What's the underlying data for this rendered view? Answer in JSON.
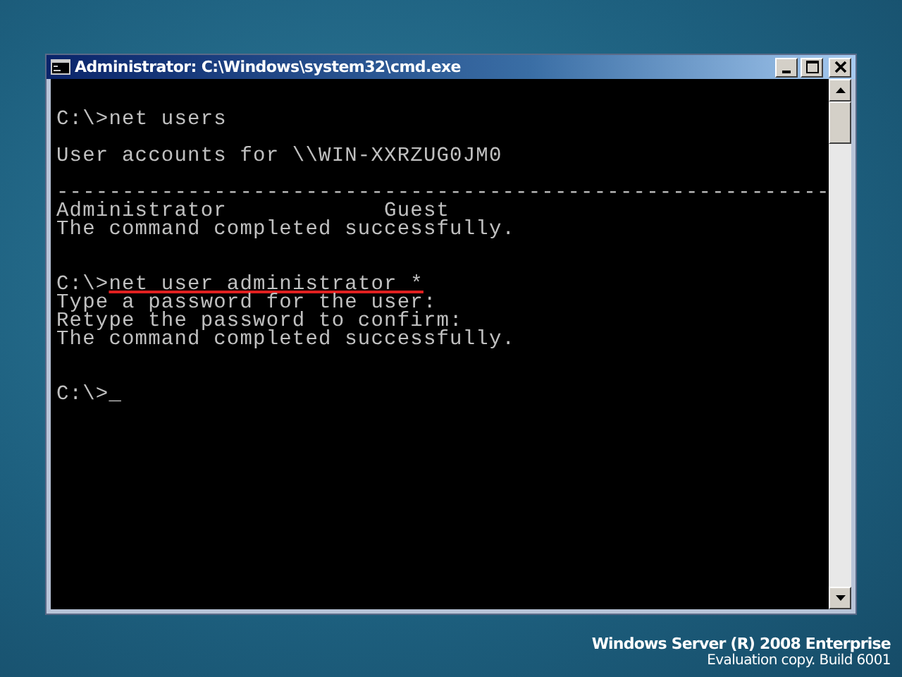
{
  "window": {
    "title": "Administrator: C:\\Windows\\system32\\cmd.exe"
  },
  "console": {
    "lines": [
      {
        "kind": "command",
        "prompt": "C:\\>",
        "text": "net users",
        "underlined": false
      },
      {
        "kind": "blank"
      },
      {
        "kind": "output",
        "text": "User accounts for \\\\WIN-XXRZUG0JM0"
      },
      {
        "kind": "blank"
      },
      {
        "kind": "output",
        "text": "-----------------------------------------------------------"
      },
      {
        "kind": "output",
        "text": "Administrator            Guest"
      },
      {
        "kind": "output",
        "text": "The command completed successfully."
      },
      {
        "kind": "blank"
      },
      {
        "kind": "blank"
      },
      {
        "kind": "command",
        "prompt": "C:\\>",
        "text": "net user administrator *",
        "underlined": true
      },
      {
        "kind": "output",
        "text": "Type a password for the user:"
      },
      {
        "kind": "output",
        "text": "Retype the password to confirm:"
      },
      {
        "kind": "output",
        "text": "The command completed successfully."
      },
      {
        "kind": "blank"
      },
      {
        "kind": "blank"
      },
      {
        "kind": "command",
        "prompt": "C:\\>",
        "text": "_",
        "underlined": false
      }
    ]
  },
  "desktop": {
    "edition": "Windows Server (R) 2008 Enterprise",
    "build": "Evaluation copy. Build 6001"
  }
}
